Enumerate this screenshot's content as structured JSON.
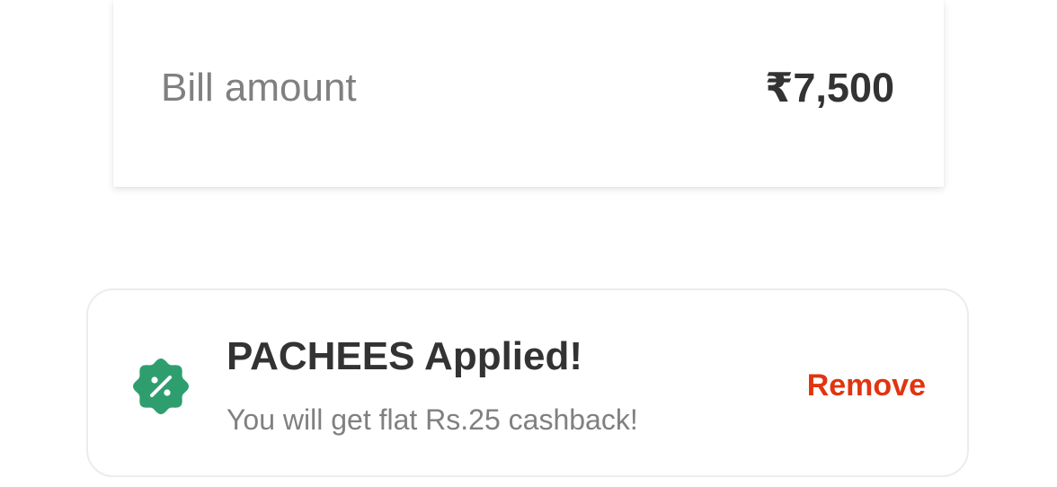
{
  "bill": {
    "label": "Bill amount",
    "amount": "₹7,500"
  },
  "coupon": {
    "title": "PACHEES Applied!",
    "description": "You will get flat Rs.25 cashback!",
    "remove_label": "Remove",
    "icon": "discount-badge-icon"
  },
  "colors": {
    "accent_green": "#2e9e6f",
    "remove_red": "#e0350f",
    "text_dark": "#333333",
    "text_muted": "#808080"
  }
}
